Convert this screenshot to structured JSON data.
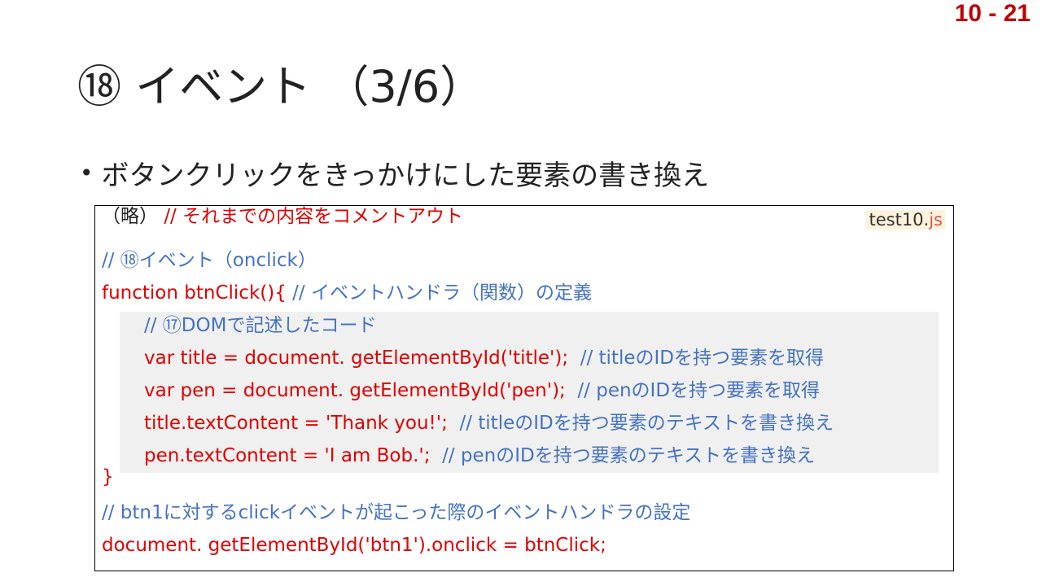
{
  "page_number": "10 - 21",
  "title": "⑱ イベント （3/6）",
  "bullet": "ボタンクリックをきっかけにした要素の書き換え",
  "code": {
    "filename_base": "test10.",
    "filename_ext": "js",
    "line1_prefix": "（略）",
    "line1_comment": "// それまでの内容をコメントアウト",
    "line2_comment": "// ⑱イベント（onclick）",
    "line3_code": "function btnClick(){",
    "line3_comment": "// イベントハンドラ（関数）の定義",
    "line4_comment": "// ⑰DOMで記述したコード",
    "line5_code": "var title = document. getElementById('title');",
    "line5_comment": "// titleのIDを持つ要素を取得",
    "line6_code": "var pen = document. getElementById('pen');",
    "line6_comment": "// penのIDを持つ要素を取得",
    "line7_code": "title.textContent = 'Thank you!';",
    "line7_comment": "// titleのIDを持つ要素のテキストを書き換え",
    "line8_code": "pen.textContent = 'I am Bob.';",
    "line8_comment": "// penのIDを持つ要素のテキストを書き換え",
    "line9_code": "}",
    "line10_comment": "// btn1に対するclickイベントが起こった際のイベントハンドラの設定",
    "line11_code": "document. getElementById('btn1').onclick = btnClick;"
  },
  "colors": {
    "code": "#e00000",
    "comment": "#4472c4",
    "page_number": "#c00000"
  }
}
